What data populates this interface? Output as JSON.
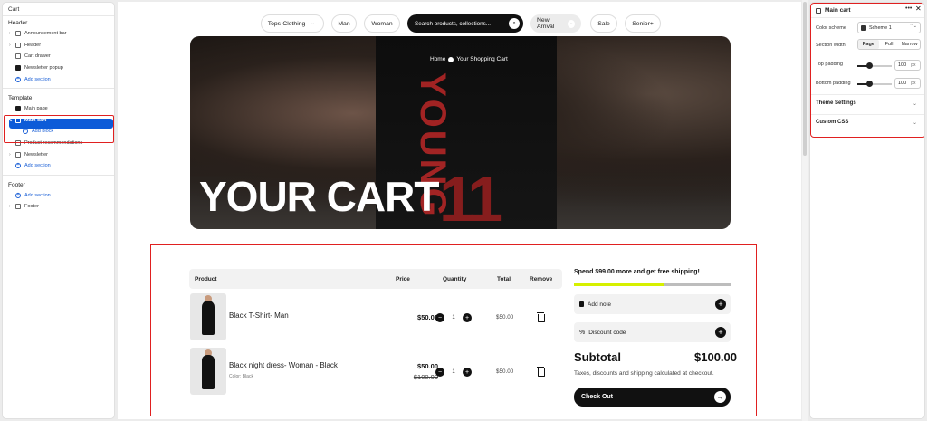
{
  "left": {
    "title": "Cart",
    "header_group": "Header",
    "header_items": [
      "Announcement bar",
      "Header",
      "Cart drawer",
      "Newsletter popup"
    ],
    "header_add": "Add section",
    "template_group": "Template",
    "template_main_page": "Main page",
    "template_selected": "Main cart",
    "template_add_block": "Add block",
    "template_items": [
      "Product recommendations",
      "Newsletter"
    ],
    "template_add": "Add section",
    "footer_group": "Footer",
    "footer_add": "Add section",
    "footer_item": "Footer"
  },
  "nav": {
    "items": [
      {
        "label": "Tops-Clothing",
        "has_chevron": true
      },
      {
        "label": "Man",
        "has_chevron": false
      },
      {
        "label": "Woman",
        "has_chevron": false
      },
      {
        "label": "New Arrival",
        "has_chevron": true
      },
      {
        "label": "Sale",
        "has_chevron": false
      },
      {
        "label": "Senior+",
        "has_chevron": false
      }
    ],
    "search_placeholder": "Search products, collections..."
  },
  "hero": {
    "breadcrumb_home": "Home",
    "breadcrumb_current": "Your Shopping Cart",
    "title": "YOUR CART",
    "shirt_word": "YOUNG",
    "shirt_number": "11"
  },
  "cart": {
    "columns": [
      "Product",
      "Price",
      "Quantity",
      "Total",
      "Remove"
    ],
    "items": [
      {
        "name": "Black T-Shirt- Man",
        "variant": "",
        "price": "$50.00",
        "old_price": "",
        "qty": "1",
        "total": "$50.00"
      },
      {
        "name": "Black night dress- Woman - Black",
        "variant": "Color: Black",
        "price": "$50.00",
        "old_price": "$100.00",
        "qty": "1",
        "total": "$50.00"
      }
    ],
    "free_shipping": "Spend $99.00 more and get free shipping!",
    "progress": 0.58,
    "add_note": "Add note",
    "discount": "Discount code",
    "subtotal_label": "Subtotal",
    "subtotal_value": "$100.00",
    "taxes": "Taxes, discounts and shipping calculated at checkout.",
    "checkout": "Check Out"
  },
  "right": {
    "title": "Main cart",
    "color_scheme_label": "Color scheme",
    "color_scheme_value": "Scheme 1",
    "section_width_label": "Section width",
    "width_options": [
      "Page",
      "Full",
      "Narrow"
    ],
    "top_padding_label": "Top padding",
    "top_padding_value": "100",
    "bottom_padding_label": "Bottom padding",
    "bottom_padding_value": "100",
    "unit": "px",
    "padding_fill": 0.35,
    "theme_settings": "Theme Settings",
    "custom_css": "Custom CSS"
  },
  "colors": {
    "accent": "#0d5bd8",
    "highlight": "#e02020",
    "progress": "#d6f000"
  }
}
